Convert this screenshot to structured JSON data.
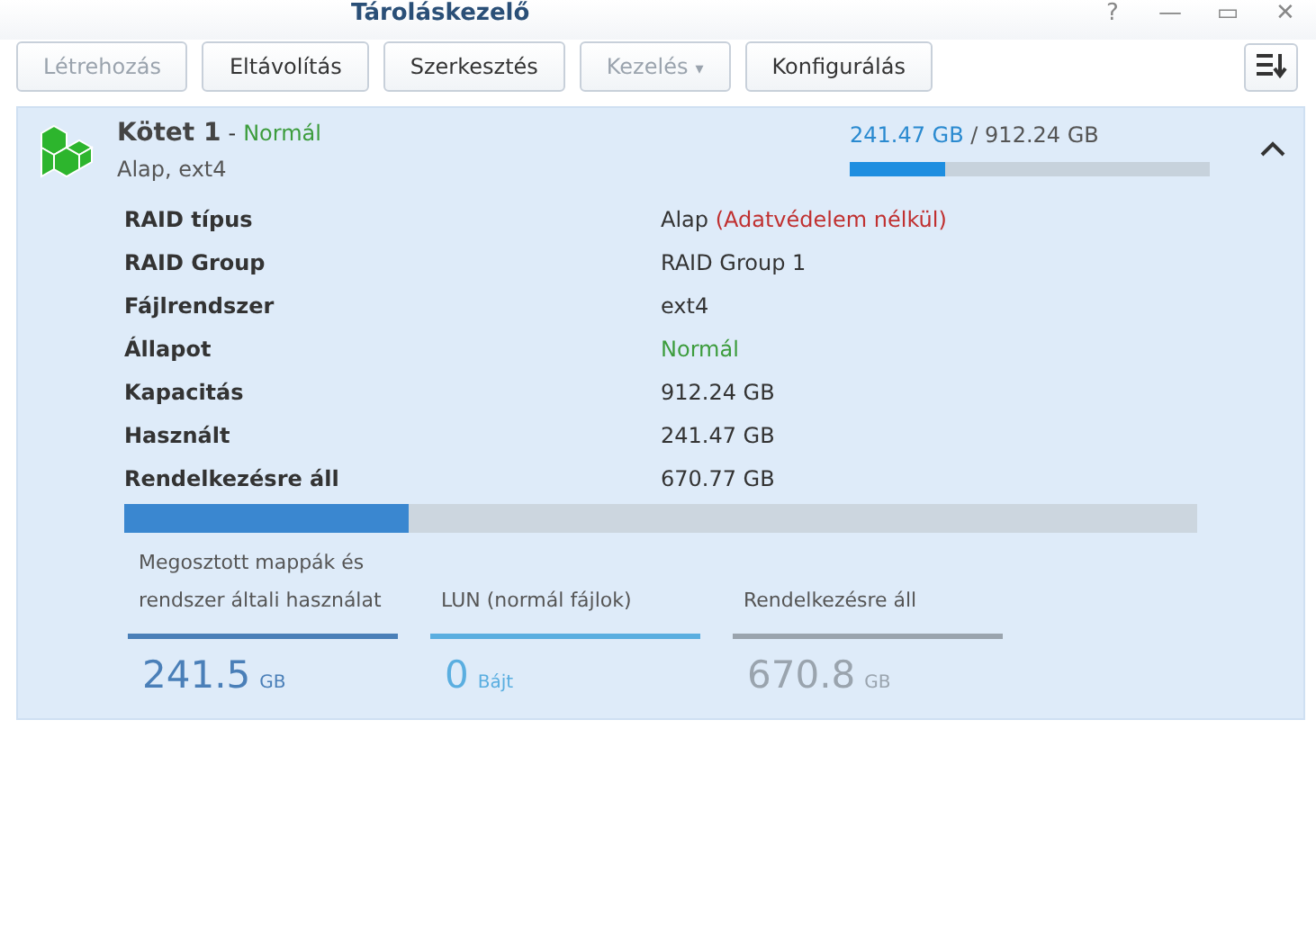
{
  "window": {
    "title": "Tároláskezelő",
    "controls": [
      "?",
      "—",
      "▭",
      "✕"
    ]
  },
  "toolbar": {
    "buttons": [
      {
        "label": "Létrehozás",
        "disabled": true
      },
      {
        "label": "Eltávolítás",
        "disabled": false
      },
      {
        "label": "Szerkesztés",
        "disabled": false
      },
      {
        "label": "Kezelés",
        "disabled": true,
        "caret": "▾"
      },
      {
        "label": "Konfigurálás",
        "disabled": false
      }
    ]
  },
  "volume": {
    "name": "Kötet 1",
    "separator": "-",
    "status": "Normál",
    "subtitle": "Alap, ext4",
    "used": "241.47 GB",
    "slash": "/",
    "total": "912.24 GB",
    "level": 0.265,
    "expanded": true,
    "details": [
      {
        "label": "RAID típus",
        "value": "Alap",
        "note": "(Adatvédelem nélkül)",
        "kind": "with-note"
      },
      {
        "label": "RAID Group",
        "value": "RAID Group 1",
        "kind": "plain"
      },
      {
        "label": "Fájlrendszer",
        "value": "ext4",
        "kind": "plain"
      },
      {
        "label": "Állapot",
        "value": "Normál",
        "kind": "status"
      },
      {
        "label": "Kapacitás",
        "value": "912.24 GB",
        "kind": "plain"
      },
      {
        "label": "Használt",
        "value": "241.47 GB",
        "kind": "plain"
      },
      {
        "label": "Rendelkezésre áll",
        "value": "670.77 GB",
        "kind": "plain"
      }
    ],
    "usage": {
      "segments": [
        {
          "level": 0.265,
          "color": "#3a87d0"
        }
      ]
    },
    "legend": [
      {
        "label": "Megosztott mappák és rendszer általi használat",
        "value": "241.5",
        "unit": "GB",
        "color": "#4a7fb8"
      },
      {
        "label": "LUN (normál fájlok)",
        "value": "0",
        "unit": "Bájt",
        "color": "#5aaee0"
      },
      {
        "label": "Rendelkezésre áll",
        "value": "670.8",
        "unit": "GB",
        "color": "#9aa4ae"
      }
    ]
  }
}
